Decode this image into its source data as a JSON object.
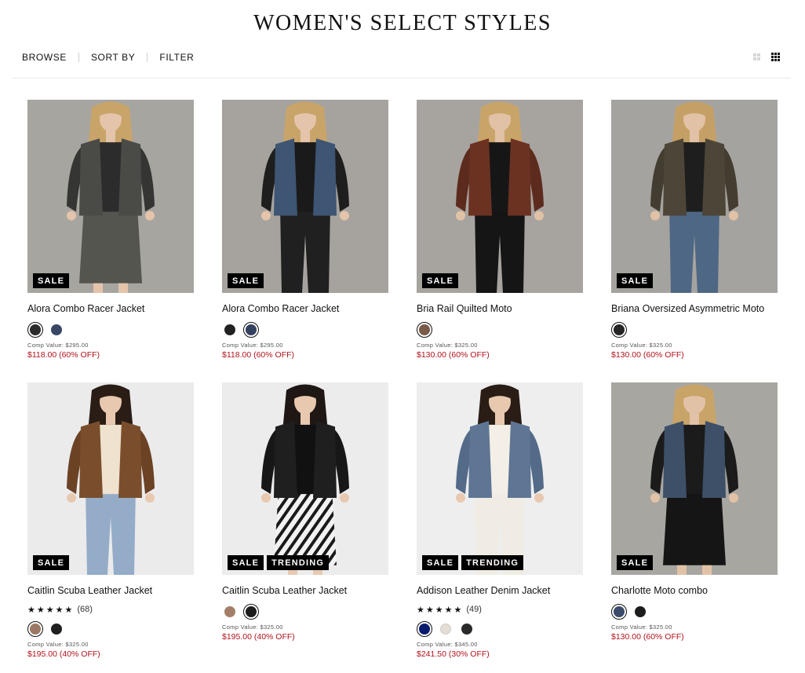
{
  "page": {
    "title": "WOMEN'S SELECT STYLES"
  },
  "toolbar": {
    "browse": "BROWSE",
    "sort": "SORT BY",
    "filter": "FILTER"
  },
  "view_toggles": [
    "grid-2-icon",
    "grid-3-icon"
  ],
  "products": [
    {
      "name": "Alora Combo Racer Jacket",
      "badges": [
        "SALE"
      ],
      "swatches": [
        "#2b2b2b",
        "#3a4666"
      ],
      "selected": 0,
      "comp": "Comp Value: $295.00",
      "price": "$118.00 (60% OFF)"
    },
    {
      "name": "Alora Combo Racer Jacket",
      "badges": [
        "SALE"
      ],
      "swatches": [
        "#222222",
        "#34405f"
      ],
      "selected": 1,
      "comp": "Comp Value: $295.00",
      "price": "$118.00 (60% OFF)"
    },
    {
      "name": "Bria Rail Quilted Moto",
      "badges": [
        "SALE"
      ],
      "swatches": [
        "#7a5a48"
      ],
      "selected": 0,
      "comp": "Comp Value: $325.00",
      "price": "$130.00 (60% OFF)"
    },
    {
      "name": "Briana Oversized Asymmetric Moto",
      "badges": [
        "SALE"
      ],
      "swatches": [
        "#252525"
      ],
      "selected": 0,
      "comp": "Comp Value: $325.00",
      "price": "$130.00 (60% OFF)"
    },
    {
      "name": "Caitlin Scuba Leather Jacket",
      "badges": [
        "SALE"
      ],
      "stars": "★★★★★",
      "rating_count": "(68)",
      "swatches": [
        "#9c7864",
        "#1f1f1f"
      ],
      "selected": 0,
      "comp": "Comp Value: $325.00",
      "price": "$195.00 (40% OFF)"
    },
    {
      "name": "Caitlin Scuba Leather Jacket",
      "badges": [
        "SALE",
        "TRENDING"
      ],
      "swatches": [
        "#a47f68",
        "#1c1c1c"
      ],
      "selected": 1,
      "comp": "Comp Value: $325.00",
      "price": "$195.00 (40% OFF)"
    },
    {
      "name": "Addison Leather Denim Jacket",
      "badges": [
        "SALE",
        "TRENDING"
      ],
      "stars": "★★★★★",
      "rating_count": "(49)",
      "swatches": [
        "#0a1a6e",
        "#e3ddd6",
        "#2a2a2a"
      ],
      "selected": 0,
      "comp": "Comp Value: $345.00",
      "price": "$241.50 (30% OFF)"
    },
    {
      "name": "Charlotte Moto combo",
      "badges": [
        "SALE"
      ],
      "swatches": [
        "#3a4a68",
        "#1c1c1c"
      ],
      "selected": 0,
      "comp": "Comp Value: $325.00",
      "price": "$130.00 (60% OFF)"
    }
  ],
  "colors": {
    "sale_price": "#b0121b",
    "badge_bg": "#000000",
    "photo_bg_gray": "#a7a5a0",
    "photo_bg_light": "#ebebec"
  }
}
